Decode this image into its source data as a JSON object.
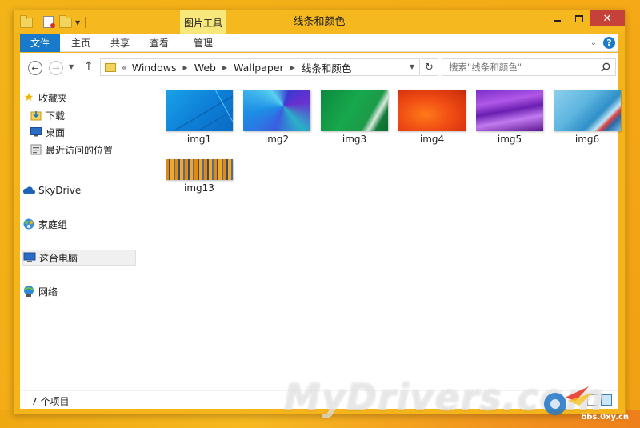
{
  "window": {
    "title": "线条和颜色",
    "context_tab": "图片工具"
  },
  "ribbon": {
    "tabs": [
      "文件",
      "主页",
      "共享",
      "查看",
      "管理"
    ]
  },
  "address": {
    "overflow": "«",
    "crumbs": [
      "Windows",
      "Web",
      "Wallpaper",
      "线条和颜色"
    ]
  },
  "search": {
    "placeholder": "搜索\"线条和颜色\""
  },
  "nav": {
    "favorites": "收藏夹",
    "downloads": "下载",
    "desktop": "桌面",
    "recent": "最近访问的位置",
    "skydrive": "SkyDrive",
    "homegroup": "家庭组",
    "thispc": "这台电脑",
    "network": "网络"
  },
  "files": [
    {
      "name": "img1"
    },
    {
      "name": "img2"
    },
    {
      "name": "img3"
    },
    {
      "name": "img4"
    },
    {
      "name": "img5"
    },
    {
      "name": "img6"
    },
    {
      "name": "img13"
    }
  ],
  "status": {
    "count_text": "7 个项目"
  },
  "watermark": {
    "text": "MyDrivers.com",
    "url": "bbs.0xy.cn"
  }
}
